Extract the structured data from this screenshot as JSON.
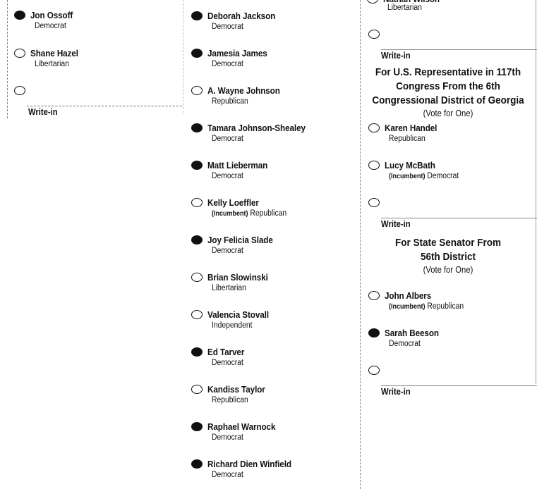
{
  "columns": [
    {
      "candidates": [
        {
          "name": "Jon Ossoff",
          "party": "Democrat",
          "incumbent": false,
          "marked": true
        },
        {
          "name": "Shane Hazel",
          "party": "Libertarian",
          "incumbent": false,
          "marked": false
        }
      ],
      "write_in_label": "Write-in"
    },
    {
      "candidates": [
        {
          "name": "Deborah Jackson",
          "party": "Democrat",
          "incumbent": false,
          "marked": true
        },
        {
          "name": "Jamesia James",
          "party": "Democrat",
          "incumbent": false,
          "marked": true
        },
        {
          "name": "A. Wayne Johnson",
          "party": "Republican",
          "incumbent": false,
          "marked": false
        },
        {
          "name": "Tamara Johnson-Shealey",
          "party": "Democrat",
          "incumbent": false,
          "marked": true
        },
        {
          "name": "Matt Lieberman",
          "party": "Democrat",
          "incumbent": false,
          "marked": true
        },
        {
          "name": "Kelly Loeffler",
          "party": "Republican",
          "incumbent": true,
          "marked": false
        },
        {
          "name": "Joy Felicia Slade",
          "party": "Democrat",
          "incumbent": false,
          "marked": true
        },
        {
          "name": "Brian Slowinski",
          "party": "Libertarian",
          "incumbent": false,
          "marked": false
        },
        {
          "name": "Valencia Stovall",
          "party": "Independent",
          "incumbent": false,
          "marked": false
        },
        {
          "name": "Ed Tarver",
          "party": "Democrat",
          "incumbent": false,
          "marked": true
        },
        {
          "name": "Kandiss Taylor",
          "party": "Republican",
          "incumbent": false,
          "marked": false
        },
        {
          "name": "Raphael Warnock",
          "party": "Democrat",
          "incumbent": false,
          "marked": true
        },
        {
          "name": "Richard Dien Winfield",
          "party": "Democrat",
          "incumbent": false,
          "marked": true
        }
      ]
    },
    {
      "partial_top": {
        "name": "Nathan Wilson",
        "party": "Libertarian"
      },
      "write_in_label": "Write-in",
      "races": [
        {
          "title_lines": [
            "For U.S. Representative in 117th",
            "Congress From the 6th",
            "Congressional District of Georgia"
          ],
          "vote_for": "(Vote for One)",
          "candidates": [
            {
              "name": "Karen Handel",
              "party": "Republican",
              "incumbent": false,
              "marked": false
            },
            {
              "name": "Lucy McBath",
              "party": "Democrat",
              "incumbent": true,
              "marked": false
            }
          ],
          "write_in_label": "Write-in"
        },
        {
          "title_lines": [
            "For State Senator From",
            "56th District"
          ],
          "vote_for": "(Vote for One)",
          "candidates": [
            {
              "name": "John Albers",
              "party": "Republican",
              "incumbent": true,
              "marked": false
            },
            {
              "name": "Sarah Beeson",
              "party": "Democrat",
              "incumbent": false,
              "marked": true
            }
          ],
          "write_in_label": "Write-in"
        }
      ]
    }
  ],
  "incumbent_label": "(Incumbent)"
}
